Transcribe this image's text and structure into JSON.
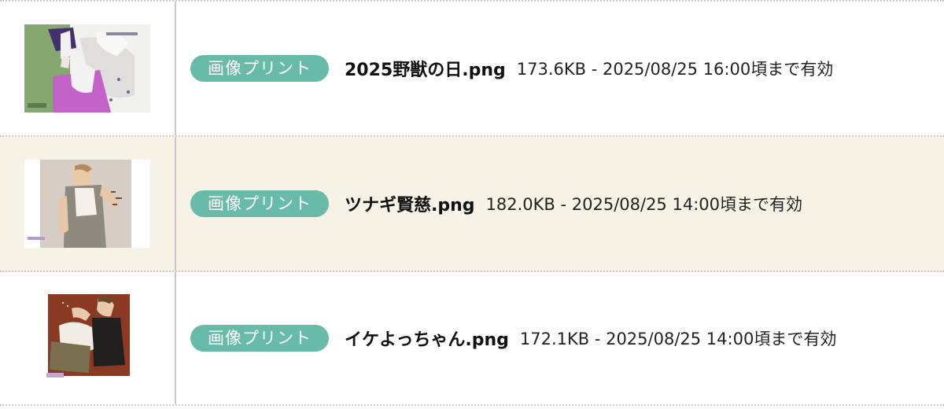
{
  "files": [
    {
      "badge": "画像プリント",
      "filename": "2025野獣の日.png",
      "meta": "173.6KB - 2025/08/25 16:00頃まで有効",
      "thumb_icon": "illustration-thumbnail"
    },
    {
      "badge": "画像プリント",
      "filename": "ツナギ賢慈.png",
      "meta": "182.0KB - 2025/08/25 14:00頃まで有効",
      "thumb_icon": "illustration-thumbnail"
    },
    {
      "badge": "画像プリント",
      "filename": "イケよっちゃん.png",
      "meta": "172.1KB - 2025/08/25 14:00頃まで有効",
      "thumb_icon": "illustration-thumbnail"
    }
  ],
  "colors": {
    "badge": "#67bba8",
    "alt_row": "#f6f2e6",
    "divider": "#cfc7c0"
  }
}
